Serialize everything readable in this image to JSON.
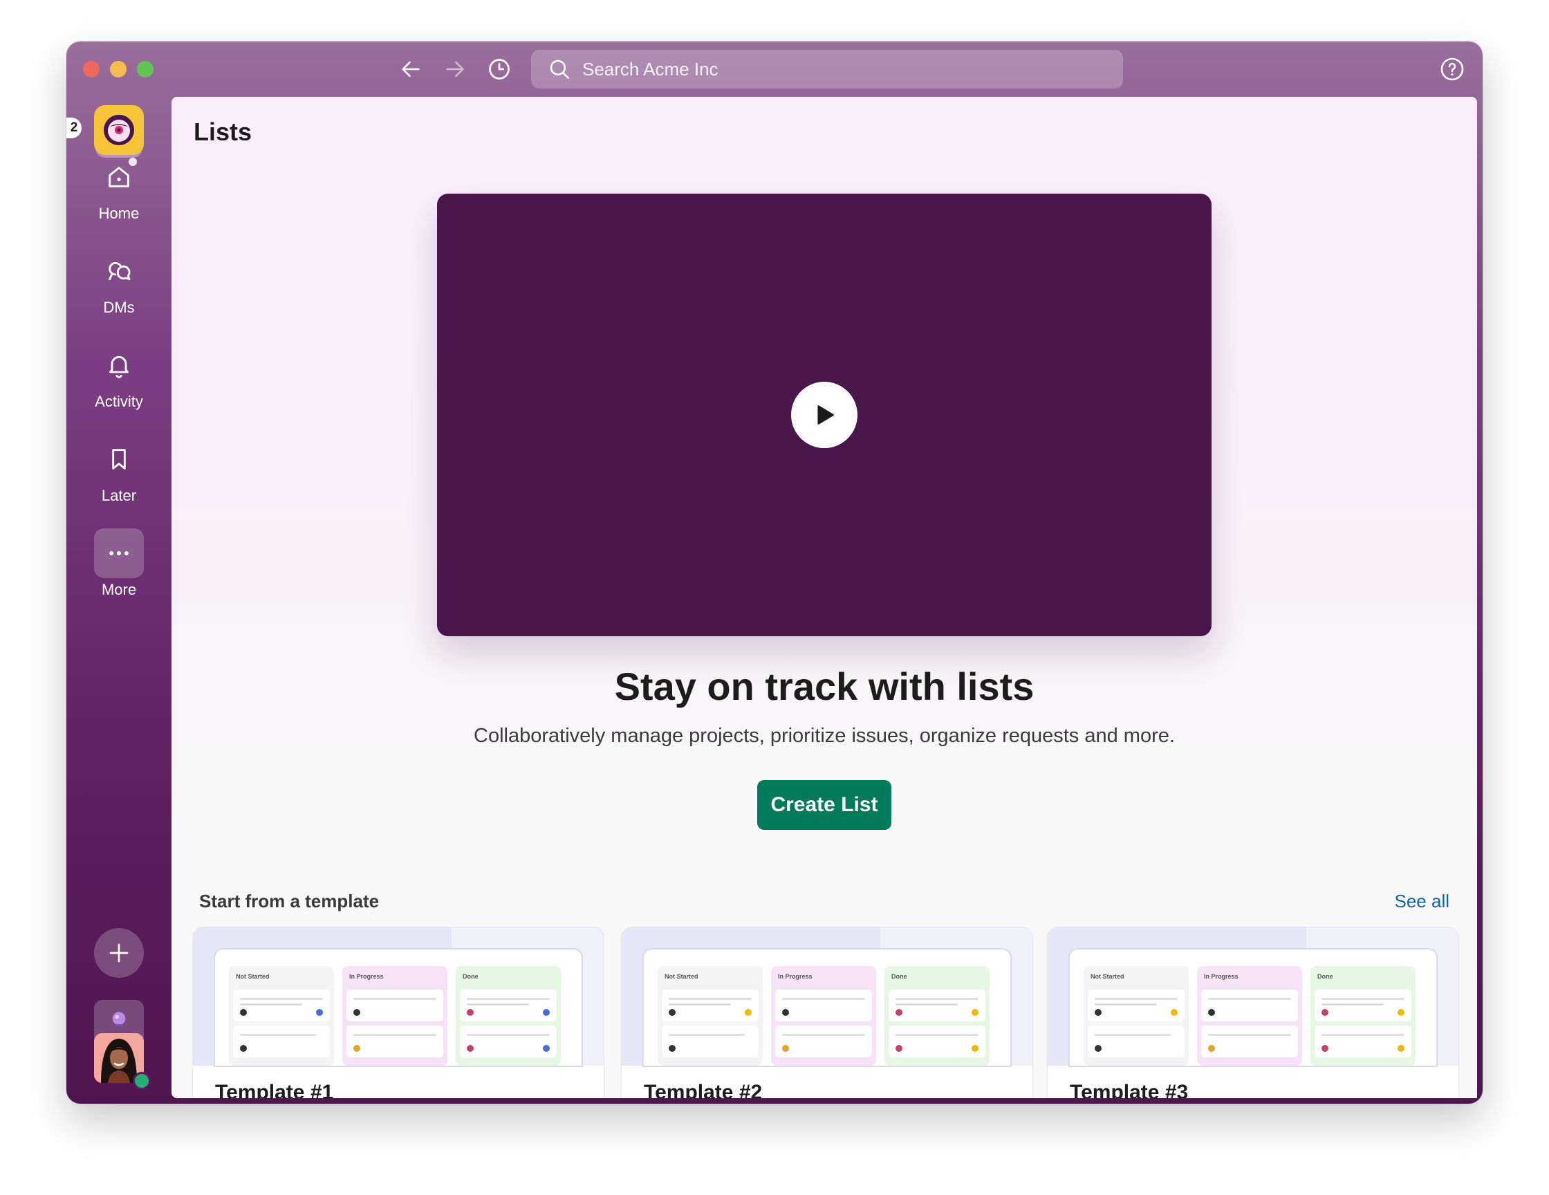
{
  "search": {
    "placeholder": "Search Acme Inc"
  },
  "workspace": {
    "badge": "2"
  },
  "rail": {
    "items": [
      {
        "label": "Home",
        "icon": "home-icon"
      },
      {
        "label": "DMs",
        "icon": "dms-icon"
      },
      {
        "label": "Activity",
        "icon": "bell-icon"
      },
      {
        "label": "Later",
        "icon": "bookmark-icon"
      },
      {
        "label": "More",
        "icon": "more-icon"
      }
    ]
  },
  "main": {
    "title": "Lists",
    "headline": "Stay on track with lists",
    "subline": "Collaboratively manage projects, prioritize issues, organize requests and more.",
    "create_label": "Create List",
    "templates_heading": "Start from a template",
    "see_all": "See all",
    "columns": [
      "Not Started",
      "In Progress",
      "Done"
    ],
    "templates": [
      {
        "name": "Template #1"
      },
      {
        "name": "Template #2"
      },
      {
        "name": "Template #3"
      }
    ]
  },
  "colors": {
    "aubergine": "#4a154b",
    "create_green": "#007a5a",
    "link_blue": "#1264a3",
    "presence_green": "#2bac76"
  }
}
